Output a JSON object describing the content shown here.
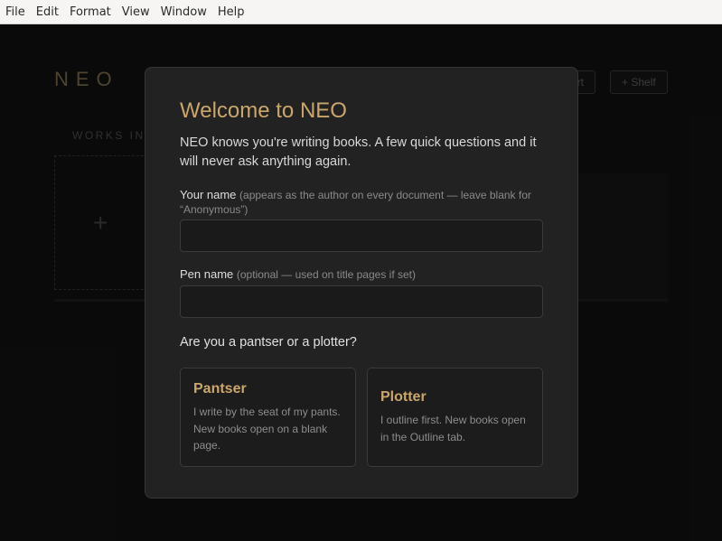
{
  "menubar": {
    "items": [
      "File",
      "Edit",
      "Format",
      "View",
      "Window",
      "Help"
    ]
  },
  "background": {
    "logo": "NEO",
    "port_button": "rt",
    "shelf_button": "+ Shelf",
    "section_label": "WORKS IN",
    "new_card": "+"
  },
  "modal": {
    "title": "Welcome to NEO",
    "intro": "NEO knows you're writing books. A few quick questions and it will never ask anything again.",
    "name_label": "Your name",
    "name_hint": "(appears as the author on every document — leave blank for “Anonymous”)",
    "name_value": "",
    "pen_label": "Pen name",
    "pen_hint": "(optional — used on title pages if set)",
    "pen_value": "",
    "question": "Are you a pantser or a plotter?",
    "choices": [
      {
        "title": "Pantser",
        "desc": "I write by the seat of my pants. New books open on a blank page."
      },
      {
        "title": "Plotter",
        "desc": "I outline first. New books open in the Outline tab."
      }
    ]
  }
}
